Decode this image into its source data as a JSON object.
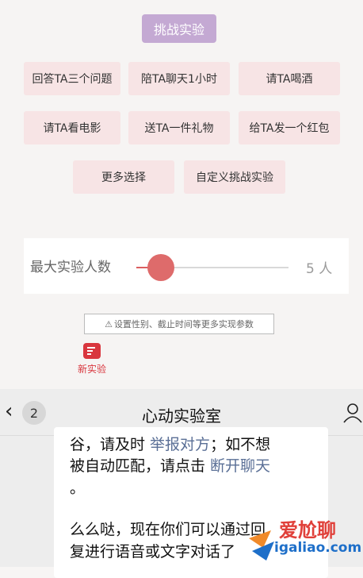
{
  "top": {
    "challenge_button": "挑战实验",
    "options": [
      "回答TA三个问题",
      "陪TA聊天1小时",
      "请TA喝酒",
      "请TA看电影",
      "送TA一件礼物",
      "给TA发一个红包",
      "更多选择",
      "自定义挑战实验"
    ],
    "max_label": "最大实验人数",
    "slider_value": "5 人",
    "slider_fraction": 0.16,
    "hint": "设置性别、截止时间等更多实现参数",
    "tab_label": "新实验"
  },
  "chat": {
    "back_count": "2",
    "title": "心动实验室",
    "lines": [
      {
        "pre": "谷，请及时 ",
        "link": "举报对方",
        "post": "；如不想"
      },
      {
        "pre": "被自动匹配，请点击 ",
        "link": "断开聊天",
        "post": ""
      },
      {
        "pre": "。",
        "link": "",
        "post": ""
      },
      {
        "pre": "么么哒，现在你们可以通过回",
        "link": "",
        "post": ""
      },
      {
        "pre": "复进行语音或文字对话了",
        "link": "",
        "post": ""
      }
    ]
  },
  "watermark": {
    "text": "爱尬聊",
    "url": "igaliao.com"
  },
  "colors": {
    "accent": "#d9363e",
    "purple": "#c4a9d3",
    "option_bg": "#f7e4e5",
    "link": "#5a6f96"
  }
}
